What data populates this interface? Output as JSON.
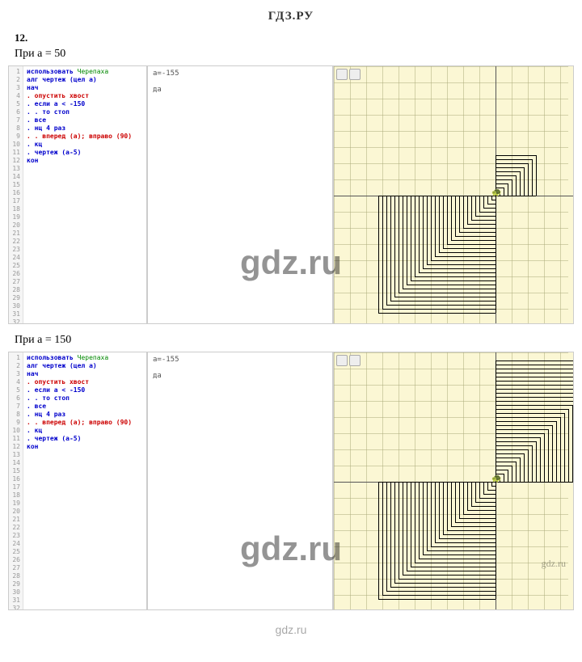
{
  "page": {
    "site_title": "ГДЗ.РУ",
    "task_number": "12.",
    "footer_watermark": "gdz.ru"
  },
  "blocks": [
    {
      "caption": "При a = 50",
      "initial_a": 50,
      "mid_pane": {
        "label": "a=-155",
        "result": "да"
      },
      "watermark": "gdz.ru",
      "canvas": {
        "grid_cell": 20,
        "spiral_step": 5,
        "spiral_count": 40,
        "turtle_glyph": "🐢"
      }
    },
    {
      "caption": "При a = 150",
      "initial_a": 150,
      "mid_pane": {
        "label": "a=-155",
        "result": "да"
      },
      "watermark": "gdz.ru",
      "watermark_small": "gdz.ru",
      "canvas": {
        "grid_cell": 20,
        "spiral_step": 5,
        "spiral_count": 60,
        "turtle_glyph": "🐢"
      }
    }
  ],
  "code": {
    "lines": [
      {
        "t": "использовать ",
        "kw": "kw-blue",
        "tail": "Черепаха",
        "tail_kw": "kw-green"
      },
      {
        "t": "алг чертеж (цел а)",
        "kw": "kw-blue"
      },
      {
        "t": "нач",
        "kw": "kw-blue"
      },
      {
        "t": ". опустить хвост",
        "kw": "kw-red"
      },
      {
        "t": ". если a < -150",
        "kw": "kw-blue"
      },
      {
        "t": ". . то стоп",
        "kw": "kw-blue"
      },
      {
        "t": ". все",
        "kw": "kw-blue"
      },
      {
        "t": ". нц 4 раз",
        "kw": "kw-blue"
      },
      {
        "t": ". . вперед (а); вправо (90)",
        "kw": "kw-red"
      },
      {
        "t": ". кц",
        "kw": "kw-blue"
      },
      {
        "t": ". чертеж (а-5)",
        "kw": "kw-blue"
      },
      {
        "t": "кон",
        "kw": "kw-blue"
      }
    ],
    "max_line": 45
  }
}
